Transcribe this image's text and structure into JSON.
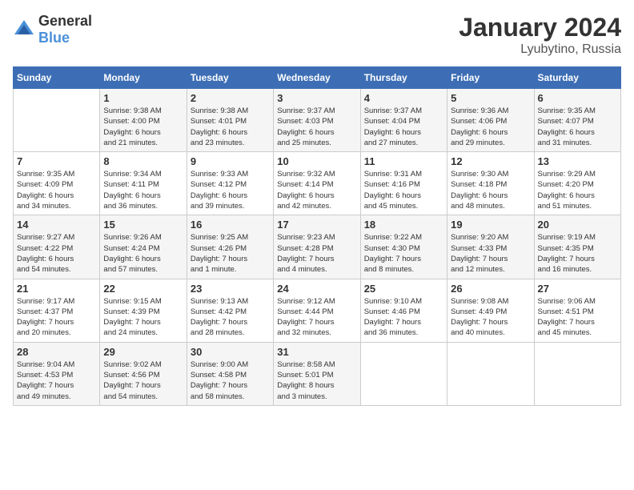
{
  "logo": {
    "general": "General",
    "blue": "Blue"
  },
  "title": "January 2024",
  "subtitle": "Lyubytino, Russia",
  "weekdays": [
    "Sunday",
    "Monday",
    "Tuesday",
    "Wednesday",
    "Thursday",
    "Friday",
    "Saturday"
  ],
  "weeks": [
    [
      {
        "day": "",
        "info": ""
      },
      {
        "day": "1",
        "info": "Sunrise: 9:38 AM\nSunset: 4:00 PM\nDaylight: 6 hours\nand 21 minutes."
      },
      {
        "day": "2",
        "info": "Sunrise: 9:38 AM\nSunset: 4:01 PM\nDaylight: 6 hours\nand 23 minutes."
      },
      {
        "day": "3",
        "info": "Sunrise: 9:37 AM\nSunset: 4:03 PM\nDaylight: 6 hours\nand 25 minutes."
      },
      {
        "day": "4",
        "info": "Sunrise: 9:37 AM\nSunset: 4:04 PM\nDaylight: 6 hours\nand 27 minutes."
      },
      {
        "day": "5",
        "info": "Sunrise: 9:36 AM\nSunset: 4:06 PM\nDaylight: 6 hours\nand 29 minutes."
      },
      {
        "day": "6",
        "info": "Sunrise: 9:35 AM\nSunset: 4:07 PM\nDaylight: 6 hours\nand 31 minutes."
      }
    ],
    [
      {
        "day": "7",
        "info": "Sunrise: 9:35 AM\nSunset: 4:09 PM\nDaylight: 6 hours\nand 34 minutes."
      },
      {
        "day": "8",
        "info": "Sunrise: 9:34 AM\nSunset: 4:11 PM\nDaylight: 6 hours\nand 36 minutes."
      },
      {
        "day": "9",
        "info": "Sunrise: 9:33 AM\nSunset: 4:12 PM\nDaylight: 6 hours\nand 39 minutes."
      },
      {
        "day": "10",
        "info": "Sunrise: 9:32 AM\nSunset: 4:14 PM\nDaylight: 6 hours\nand 42 minutes."
      },
      {
        "day": "11",
        "info": "Sunrise: 9:31 AM\nSunset: 4:16 PM\nDaylight: 6 hours\nand 45 minutes."
      },
      {
        "day": "12",
        "info": "Sunrise: 9:30 AM\nSunset: 4:18 PM\nDaylight: 6 hours\nand 48 minutes."
      },
      {
        "day": "13",
        "info": "Sunrise: 9:29 AM\nSunset: 4:20 PM\nDaylight: 6 hours\nand 51 minutes."
      }
    ],
    [
      {
        "day": "14",
        "info": "Sunrise: 9:27 AM\nSunset: 4:22 PM\nDaylight: 6 hours\nand 54 minutes."
      },
      {
        "day": "15",
        "info": "Sunrise: 9:26 AM\nSunset: 4:24 PM\nDaylight: 6 hours\nand 57 minutes."
      },
      {
        "day": "16",
        "info": "Sunrise: 9:25 AM\nSunset: 4:26 PM\nDaylight: 7 hours\nand 1 minute."
      },
      {
        "day": "17",
        "info": "Sunrise: 9:23 AM\nSunset: 4:28 PM\nDaylight: 7 hours\nand 4 minutes."
      },
      {
        "day": "18",
        "info": "Sunrise: 9:22 AM\nSunset: 4:30 PM\nDaylight: 7 hours\nand 8 minutes."
      },
      {
        "day": "19",
        "info": "Sunrise: 9:20 AM\nSunset: 4:33 PM\nDaylight: 7 hours\nand 12 minutes."
      },
      {
        "day": "20",
        "info": "Sunrise: 9:19 AM\nSunset: 4:35 PM\nDaylight: 7 hours\nand 16 minutes."
      }
    ],
    [
      {
        "day": "21",
        "info": "Sunrise: 9:17 AM\nSunset: 4:37 PM\nDaylight: 7 hours\nand 20 minutes."
      },
      {
        "day": "22",
        "info": "Sunrise: 9:15 AM\nSunset: 4:39 PM\nDaylight: 7 hours\nand 24 minutes."
      },
      {
        "day": "23",
        "info": "Sunrise: 9:13 AM\nSunset: 4:42 PM\nDaylight: 7 hours\nand 28 minutes."
      },
      {
        "day": "24",
        "info": "Sunrise: 9:12 AM\nSunset: 4:44 PM\nDaylight: 7 hours\nand 32 minutes."
      },
      {
        "day": "25",
        "info": "Sunrise: 9:10 AM\nSunset: 4:46 PM\nDaylight: 7 hours\nand 36 minutes."
      },
      {
        "day": "26",
        "info": "Sunrise: 9:08 AM\nSunset: 4:49 PM\nDaylight: 7 hours\nand 40 minutes."
      },
      {
        "day": "27",
        "info": "Sunrise: 9:06 AM\nSunset: 4:51 PM\nDaylight: 7 hours\nand 45 minutes."
      }
    ],
    [
      {
        "day": "28",
        "info": "Sunrise: 9:04 AM\nSunset: 4:53 PM\nDaylight: 7 hours\nand 49 minutes."
      },
      {
        "day": "29",
        "info": "Sunrise: 9:02 AM\nSunset: 4:56 PM\nDaylight: 7 hours\nand 54 minutes."
      },
      {
        "day": "30",
        "info": "Sunrise: 9:00 AM\nSunset: 4:58 PM\nDaylight: 7 hours\nand 58 minutes."
      },
      {
        "day": "31",
        "info": "Sunrise: 8:58 AM\nSunset: 5:01 PM\nDaylight: 8 hours\nand 3 minutes."
      },
      {
        "day": "",
        "info": ""
      },
      {
        "day": "",
        "info": ""
      },
      {
        "day": "",
        "info": ""
      }
    ]
  ]
}
